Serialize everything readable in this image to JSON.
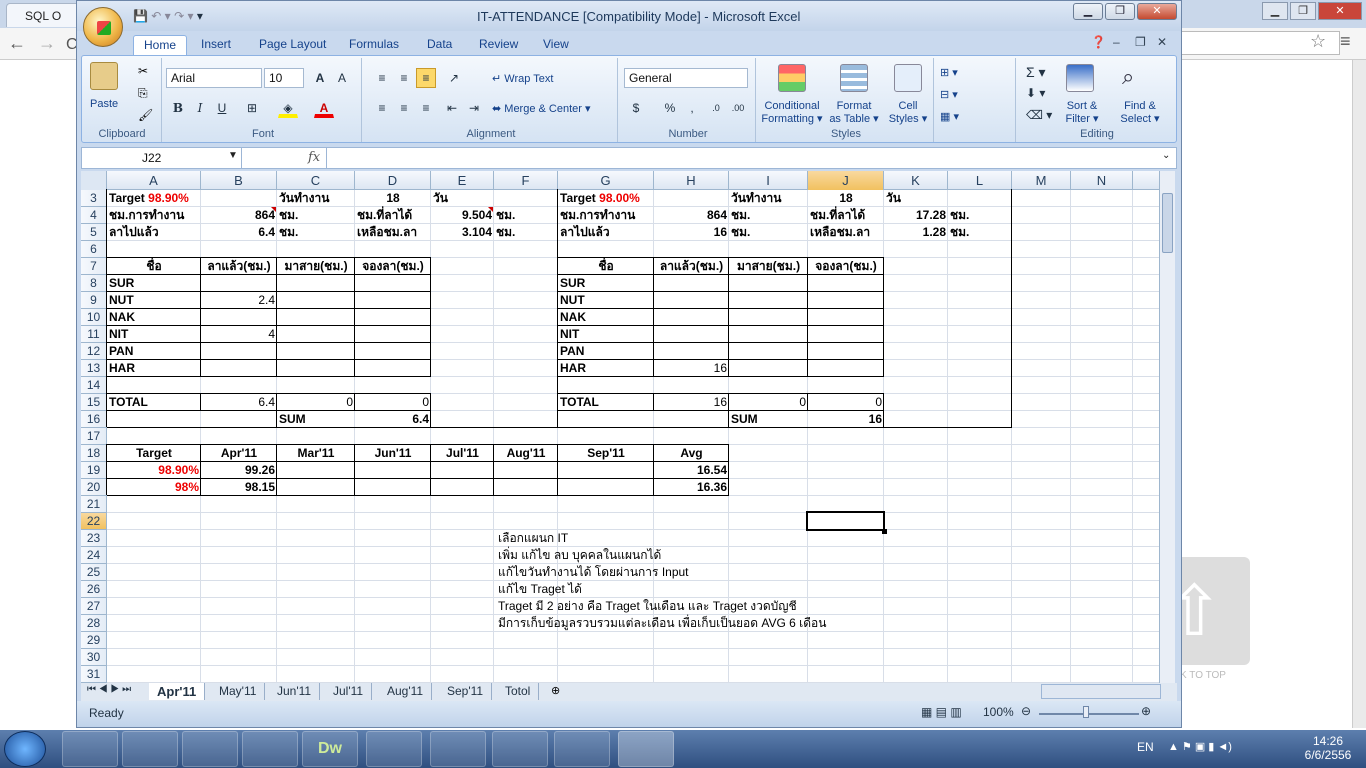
{
  "browser": {
    "tab_title": "SQL O",
    "omnibox_fragment": "C"
  },
  "excel": {
    "title": "IT-ATTENDANCE  [Compatibility Mode] - Microsoft Excel",
    "ribbon_tabs": [
      "Home",
      "Insert",
      "Page Layout",
      "Formulas",
      "Data",
      "Review",
      "View"
    ],
    "clipboard": {
      "paste": "Paste",
      "group": "Clipboard"
    },
    "font": {
      "name": "Arial",
      "size": "10",
      "group": "Font"
    },
    "alignment": {
      "wrap": "Wrap Text",
      "merge": "Merge & Center",
      "group": "Alignment"
    },
    "number": {
      "format": "General",
      "group": "Number"
    },
    "styles": {
      "conditional": "Conditional",
      "conditional2": "Formatting",
      "format_table": "Format",
      "format_table2": "as Table",
      "cell_styles": "Cell",
      "cell_styles2": "Styles",
      "group": "Styles"
    },
    "cells": {
      "a3_label": "Target",
      "a3_value": "98.90%",
      "c3": "วันทำงาน",
      "d3": "18",
      "e3": "วัน",
      "g3_label": "Target",
      "g3_value": "98.00%",
      "i3": "วันทำงาน",
      "j3": "18",
      "k3": "วัน",
      "a4": "ชม.การทำงาน",
      "b4": "864",
      "c4": "ชม.",
      "d4": "ชม.ที่ลาได้",
      "e4": "9.504",
      "f4": "ชม.",
      "g4": "ชม.การทำงาน",
      "h4": "864",
      "i4": "ชม.",
      "j4": "ชม.ที่ลาได้",
      "k4": "17.28",
      "l4": "ชม.",
      "a5": "ลาไปแล้ว",
      "b5": "6.4",
      "c5": "ชม.",
      "d5": "เหลือชม.ลา",
      "e5": "3.104",
      "f5": "ชม.",
      "g5": "ลาไปแล้ว",
      "h5": "16",
      "i5": "ชม.",
      "j5": "เหลือชม.ลา",
      "k5": "1.28",
      "l5": "ชม.",
      "hdr_name": "ชื่อ",
      "hdr_leave": "ลาแล้ว(ชม.)",
      "hdr_late": "มาสาย(ชม.)",
      "hdr_reserve": "จองลา(ชม.)",
      "names": [
        "SUR",
        "NUT",
        "NAK",
        "NIT",
        "PAN",
        "HAR"
      ],
      "left_leave": [
        "",
        "2.4",
        "",
        "4",
        "",
        ""
      ],
      "right_leave": [
        "",
        "",
        "",
        "",
        "",
        "16"
      ],
      "total": "TOTAL",
      "left_total": [
        "6.4",
        "0",
        "0"
      ],
      "right_total": [
        "16",
        "0",
        "0"
      ],
      "sum": "SUM",
      "left_sum": "6.4",
      "right_sum": "16",
      "summary_headers": [
        "Target",
        "Apr'11",
        "Mar'11",
        "Jun'11",
        "Jul'11",
        "Aug'11",
        "Sep'11",
        "Avg"
      ],
      "row19": {
        "target": "98.90%",
        "apr": "99.26",
        "avg": "16.54"
      },
      "row20": {
        "target": "98%",
        "apr": "98.15",
        "avg": "16.36"
      },
      "notes": [
        "เลือกแผนก IT",
        "เพิ่ม  แก้ไข  ลบ  บุคคลในแผนกได้",
        "แก้ไขวันทำงานได้  โดยผ่านการ  Input",
        "แก้ไข   Traget  ได้",
        "Traget มี   2 อย่าง   คือ   Traget ในเดือน   และ   Traget งวดบัญชี",
        "มีการเก็บข้อมูลรวบรวมแต่ละเดือน   เพื่อเก็บเป็นยอด   AVG 6 เดือน"
      ]
    },
    "editing": {
      "sort": "Sort &",
      "sort2": "Filter",
      "find": "Find &",
      "find2": "Select",
      "group": "Editing"
    },
    "name_box": "J22",
    "fx": "fx",
    "columns": [
      "A",
      "B",
      "C",
      "D",
      "E",
      "F",
      "G",
      "H",
      "I",
      "J",
      "K",
      "L",
      "M",
      "N"
    ],
    "rows": [
      "3",
      "4",
      "5",
      "6",
      "7",
      "8",
      "9",
      "10",
      "11",
      "12",
      "13",
      "14",
      "15",
      "16",
      "17",
      "18",
      "19",
      "20",
      "21",
      "22",
      "23",
      "24",
      "25",
      "26",
      "27",
      "28",
      "29",
      "30",
      "31"
    ],
    "sheets": [
      "Apr'11",
      "May'11",
      "Jun'11",
      "Jul'11",
      "Aug'11",
      "Sep'11",
      "Totol"
    ],
    "status": "Ready",
    "zoom": "100%"
  },
  "backtotop": "K TO TOP",
  "taskbar": {
    "lang": "EN",
    "time": "14:26",
    "date": "6/6/2556",
    "dreamweaver": "Dw"
  }
}
